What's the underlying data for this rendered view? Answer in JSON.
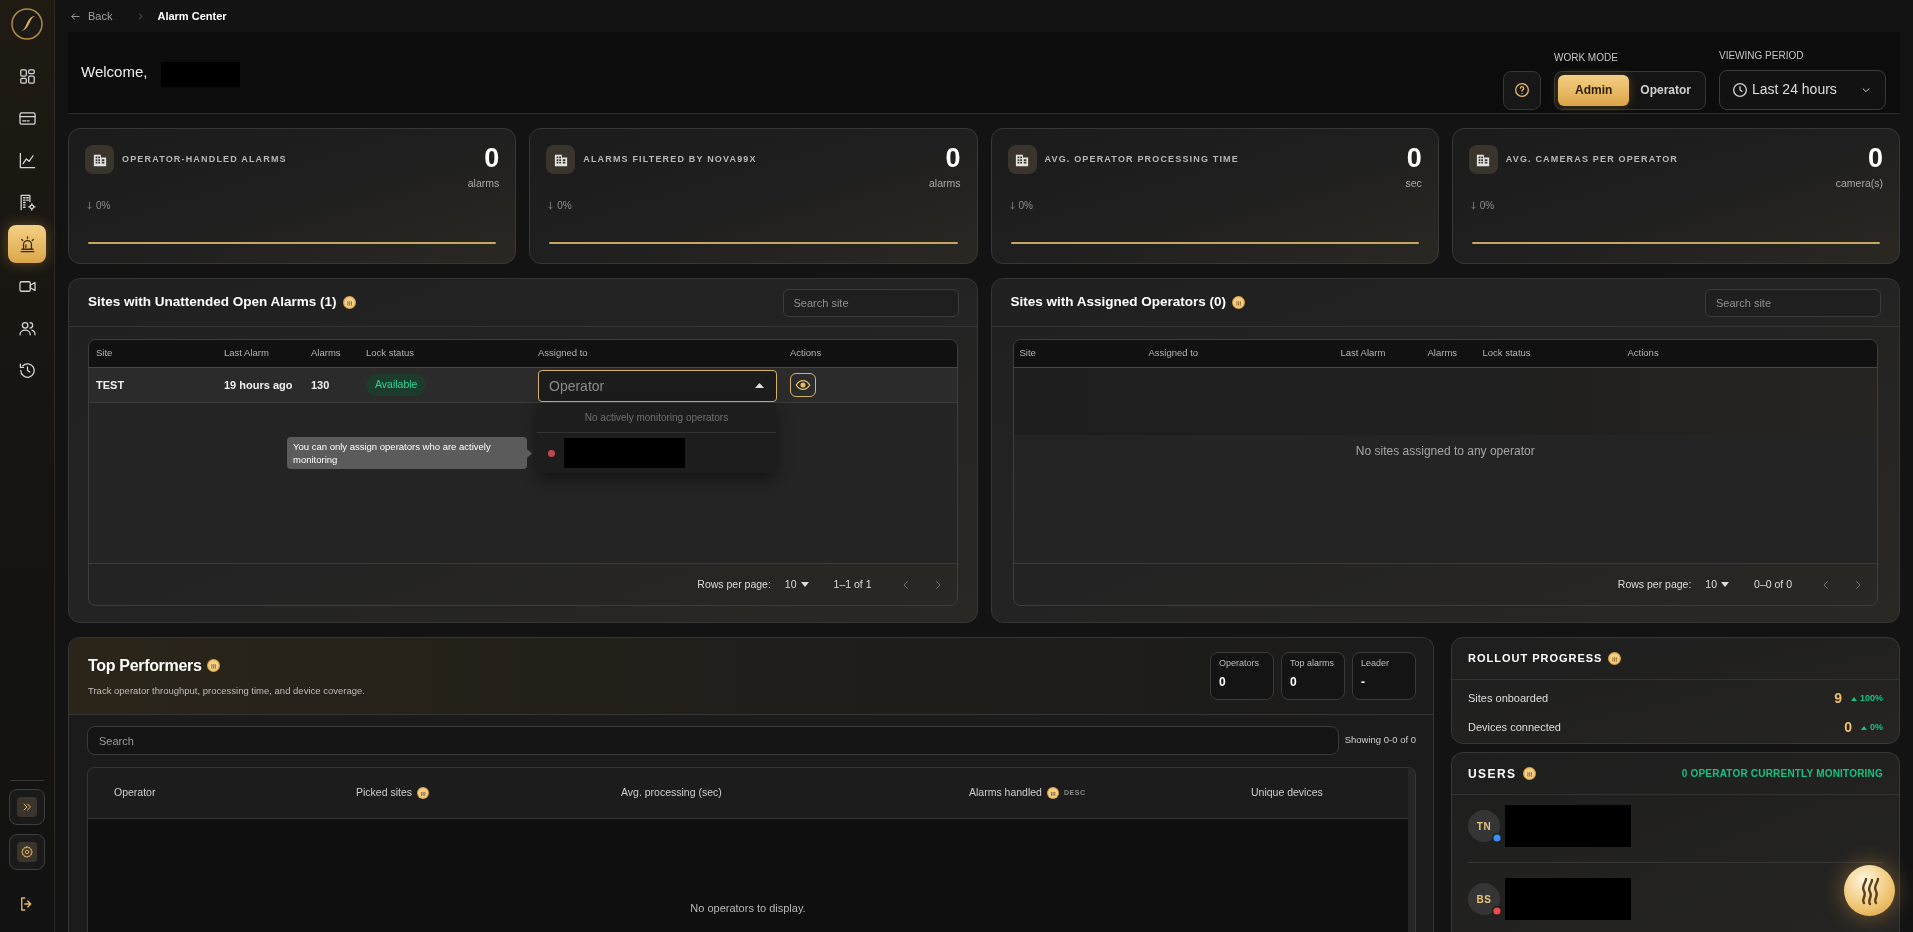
{
  "sidebar": {
    "nav_items": [
      {
        "selected": false
      },
      {
        "selected": false
      },
      {
        "selected": false
      },
      {
        "selected": false
      },
      {
        "selected": true
      },
      {
        "selected": false
      },
      {
        "selected": false
      },
      {
        "selected": false
      }
    ]
  },
  "breadcrumb": {
    "back": "Back",
    "current": "Alarm Center"
  },
  "header": {
    "welcome": "Welcome,",
    "name_redacted": true,
    "work_mode": {
      "label": "WORK MODE",
      "options": [
        {
          "label": "Admin",
          "selected": true
        },
        {
          "label": "Operator",
          "selected": false
        }
      ]
    },
    "viewing_period": {
      "label": "VIEWING PERIOD",
      "value": "Last 24 hours"
    }
  },
  "stat_cards": [
    {
      "title": "OPERATOR-HANDLED ALARMS",
      "value": "0",
      "unit": "alarms",
      "change": "0%"
    },
    {
      "title": "ALARMS FILTERED BY NOVA99X",
      "value": "0",
      "unit": "alarms",
      "change": "0%"
    },
    {
      "title": "AVG. OPERATOR PROCESSING TIME",
      "value": "0",
      "unit": "sec",
      "change": "0%"
    },
    {
      "title": "AVG. CAMERAS PER OPERATOR",
      "value": "0",
      "unit": "camera(s)",
      "change": "0%"
    }
  ],
  "unattended_sites": {
    "title": "Sites with Unattended Open Alarms (1)",
    "search": {
      "placeholder": "Search site"
    },
    "columns": [
      "Site",
      "Last Alarm",
      "Alarms",
      "Lock status",
      "Assigned to",
      "Actions"
    ],
    "rows": [
      {
        "site": "TEST",
        "last_alarm": "19 hours ago",
        "alarms": "130",
        "lock_status": "Available",
        "assign": {
          "placeholder": "Operator",
          "expanded": true
        }
      }
    ],
    "assign_menu": {
      "note": "No actively monitoring operators",
      "options": [
        {
          "color": "#c0474a",
          "name_redacted": true
        }
      ]
    },
    "tooltip": "You can only assign operators who are actively monitoring",
    "pagination": {
      "rows_label": "Rows per page:",
      "rows_value": "10",
      "range": "1–1 of 1"
    }
  },
  "assigned_sites": {
    "title": "Sites with Assigned Operators (0)",
    "search": {
      "placeholder": "Search site"
    },
    "columns": [
      "Site",
      "Assigned to",
      "Last Alarm",
      "Alarms",
      "Lock status",
      "Actions"
    ],
    "empty_message": "No sites assigned to any operator",
    "pagination": {
      "rows_label": "Rows per page:",
      "rows_value": "10",
      "range": "0–0 of 0"
    }
  },
  "top_performers": {
    "title": "Top Performers",
    "subtitle": "Track operator throughput, processing time, and device coverage.",
    "stats": [
      {
        "label": "Operators",
        "value": "0"
      },
      {
        "label": "Top alarms",
        "value": "0"
      },
      {
        "label": "Leader",
        "value": "-"
      }
    ],
    "search": {
      "placeholder": "Search"
    },
    "showing": "Showing 0-0 of 0",
    "columns": [
      {
        "label": "Operator",
        "info": false
      },
      {
        "label": "Picked sites",
        "info": true
      },
      {
        "label": "Avg. processing (sec)",
        "info": false
      },
      {
        "label": "Alarms handled",
        "info": true,
        "sort": "DESC"
      },
      {
        "label": "Unique devices",
        "info": false
      }
    ],
    "empty_message": "No operators to display."
  },
  "rollout_progress": {
    "title": "ROLLOUT PROGRESS",
    "rows": [
      {
        "label": "Sites onboarded",
        "value": "9",
        "change": "100%"
      },
      {
        "label": "Devices connected",
        "value": "0",
        "change": "0%"
      }
    ]
  },
  "users": {
    "title": "USERS",
    "monitoring": "0 OPERATOR CURRENTLY MONITORING",
    "items": [
      {
        "initials": "TN",
        "color": "#3b8ef0",
        "name_redacted": true
      },
      {
        "initials": "BS",
        "color": "#ef4a4f",
        "name_redacted": true
      }
    ]
  }
}
